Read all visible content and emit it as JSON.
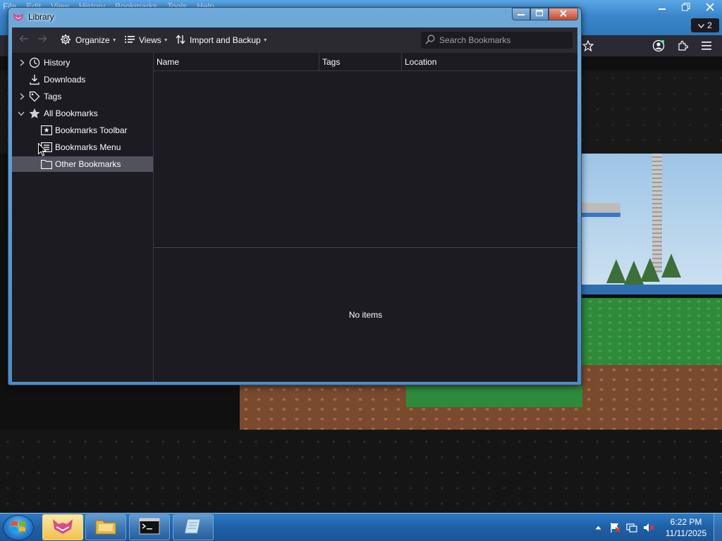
{
  "browser": {
    "menu": [
      "File",
      "Edit",
      "View",
      "History",
      "Bookmarks",
      "Tools",
      "Help"
    ],
    "tab_count": "2"
  },
  "library": {
    "title": "Library",
    "toolbar": {
      "organize": "Organize",
      "views": "Views",
      "import_backup": "Import and Backup",
      "search_placeholder": "Search Bookmarks"
    },
    "sidebar": [
      {
        "label": "History",
        "icon": "clock-icon",
        "expandable": true,
        "expanded": false
      },
      {
        "label": "Downloads",
        "icon": "download-icon",
        "expandable": false
      },
      {
        "label": "Tags",
        "icon": "tag-icon",
        "expandable": true,
        "expanded": false
      },
      {
        "label": "All Bookmarks",
        "icon": "star-icon",
        "expandable": true,
        "expanded": true
      },
      {
        "label": "Bookmarks Toolbar",
        "icon": "bookmarks-toolbar-icon",
        "child": true
      },
      {
        "label": "Bookmarks Menu",
        "icon": "bookmarks-menu-icon",
        "child": true
      },
      {
        "label": "Other Bookmarks",
        "icon": "folder-icon",
        "child": true,
        "selected": true
      }
    ],
    "columns": [
      "Name",
      "Tags",
      "Location"
    ],
    "details_text": "No items"
  },
  "taskbar": {
    "apps": [
      "firefox-icon",
      "file-explorer-icon",
      "command-prompt-icon",
      "notepad-icon"
    ],
    "clock_time": "6:22 PM",
    "clock_date": "11/11/2025"
  },
  "colors": {
    "panel_bg": "#1c1b22",
    "toolbar_bg": "#2b2a33",
    "selection": "#52525e",
    "text": "#fbfbfe",
    "taskbar": "#1f5fa6"
  }
}
